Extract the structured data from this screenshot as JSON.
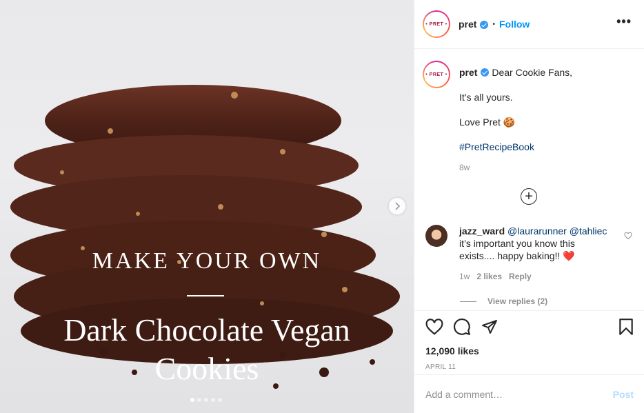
{
  "media": {
    "kicker": "MAKE YOUR OWN",
    "title_line1": "Dark Chocolate Vegan",
    "title_line2": "Cookies",
    "carousel": {
      "count": 5,
      "active_index": 0
    },
    "next_icon": "chevron-right-icon"
  },
  "header": {
    "avatar_text": "• PRET •",
    "username": "pret",
    "separator": "•",
    "follow_label": "Follow",
    "more_label": "•••"
  },
  "caption": {
    "username": "pret",
    "line1": "Dear Cookie Fans,",
    "line2": "It’s all yours.",
    "line3": "Love Pret 🍪",
    "hashtag": "#PretRecipeBook",
    "time": "8w"
  },
  "load_more_label": "+",
  "comment": {
    "username": "jazz_ward",
    "mention1": "@laurarunner",
    "mention2": "@tahliec",
    "text": " it’s important you know this exists.... happy baking!! ❤️",
    "time": "1w",
    "likes": "2 likes",
    "reply_label": "Reply",
    "view_replies": "View replies (2)"
  },
  "actions": {
    "likes": "12,090 likes",
    "date": "APRIL 11"
  },
  "add_comment": {
    "placeholder": "Add a comment…",
    "post_label": "Post"
  },
  "colors": {
    "accent": "#0095f6",
    "verified": "#3897f0",
    "hashtag": "#00376b",
    "muted": "#8e8e8e",
    "post_disabled": "#b3dbff"
  }
}
